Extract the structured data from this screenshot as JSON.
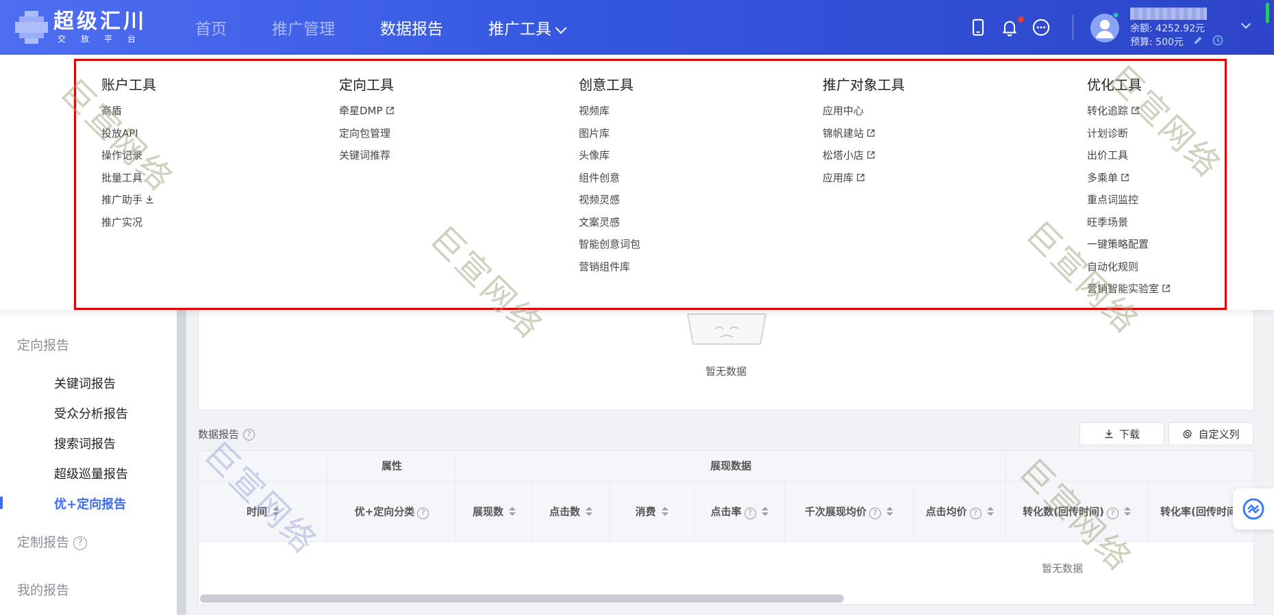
{
  "header": {
    "logo_title": "超级汇川",
    "logo_sub": "交放平台",
    "nav": [
      {
        "label": "首页"
      },
      {
        "label": "推广管理"
      },
      {
        "label": "数据报告"
      },
      {
        "label": "推广工具"
      }
    ],
    "balance": "余额: 4252.92元",
    "budget": "预算: 500元"
  },
  "dropdown": {
    "columns": [
      {
        "title": "账户工具",
        "items": [
          "商盾",
          "投放API",
          "操作记录",
          "批量工具",
          "推广助手",
          "推广实况"
        ]
      },
      {
        "title": "定向工具",
        "items": [
          "牵星DMP",
          "定向包管理",
          "关键词推荐"
        ]
      },
      {
        "title": "创意工具",
        "items": [
          "视频库",
          "图片库",
          "头像库",
          "组件创意",
          "视频灵感",
          "文案灵感",
          "智能创意词包",
          "营销组件库"
        ]
      },
      {
        "title": "推广对象工具",
        "items": [
          "应用中心",
          "锦帆建站",
          "松塔小店",
          "应用库"
        ]
      },
      {
        "title": "优化工具",
        "items": [
          "转化追踪",
          "计划诊断",
          "出价工具",
          "多乘单",
          "重点词监控",
          "旺季场景",
          "一键策略配置",
          "自动化规则",
          "营销智能实验室"
        ]
      }
    ]
  },
  "sidebar": {
    "group_targeting": "定向报告",
    "items": [
      "关键词报告",
      "受众分析报告",
      "搜索词报告",
      "超级巡量报告",
      "优+定向报告"
    ],
    "group_custom": "定制报告",
    "group_mine": "我的报告"
  },
  "main": {
    "empty_text": "暂无数据",
    "section_title": "数据报告",
    "download_label": "下载",
    "custom_cols_label": "自定义列",
    "table": {
      "group_headers": [
        "属性",
        "展现数据"
      ],
      "headers": [
        "时间",
        "优+定向分类",
        "展现数",
        "点击数",
        "消费",
        "点击率",
        "千次展现均价",
        "点击均价",
        "转化数(回传时间)",
        "转化率(回传时间"
      ],
      "empty_text": "暂无数据"
    }
  },
  "watermark": "巨宣网络",
  "colors": {
    "header_start": "#4e6ef2",
    "header_end": "#2d45c8",
    "accent": "#3a6cf4",
    "highlight_frame": "#e00000"
  }
}
